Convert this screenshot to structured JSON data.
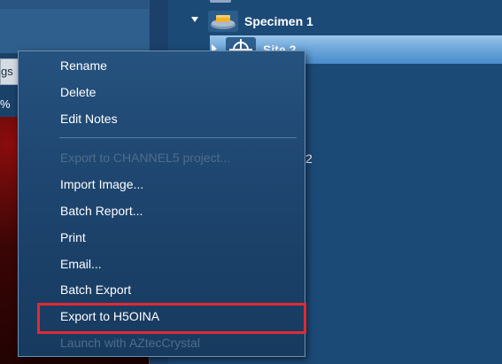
{
  "left_panel": {
    "tab_fragment": "gs",
    "percent_fragment": "%"
  },
  "tree": {
    "specimen": {
      "label": "Specimen 1",
      "expanded": true
    },
    "site": {
      "label": "Site 2",
      "selected": true
    },
    "peek_text": "2"
  },
  "context_menu": {
    "items": [
      {
        "label": "Rename",
        "enabled": true
      },
      {
        "label": "Delete",
        "enabled": true
      },
      {
        "label": "Edit Notes",
        "enabled": true
      },
      {
        "label": "Export to CHANNEL5 project...",
        "enabled": false
      },
      {
        "label": "Import Image...",
        "enabled": true
      },
      {
        "label": "Batch Report...",
        "enabled": true
      },
      {
        "label": "Print",
        "enabled": true
      },
      {
        "label": "Email...",
        "enabled": true
      },
      {
        "label": "Batch Export",
        "enabled": true
      },
      {
        "label": "Export to H5OINA",
        "enabled": true,
        "highlighted": true
      },
      {
        "label": "Launch with AZtecCrystal",
        "enabled": false
      }
    ]
  },
  "colors": {
    "highlight_outline": "#e02a34",
    "menu_text": "#ffffff",
    "menu_text_disabled": "#4f6d8c",
    "selection": "#6fa8db"
  },
  "icons": {
    "specimen": "specimen-stage-icon",
    "site": "site-crosshair-icon",
    "expander_open": "triangle-down-icon",
    "expander_closed": "triangle-right-icon"
  }
}
